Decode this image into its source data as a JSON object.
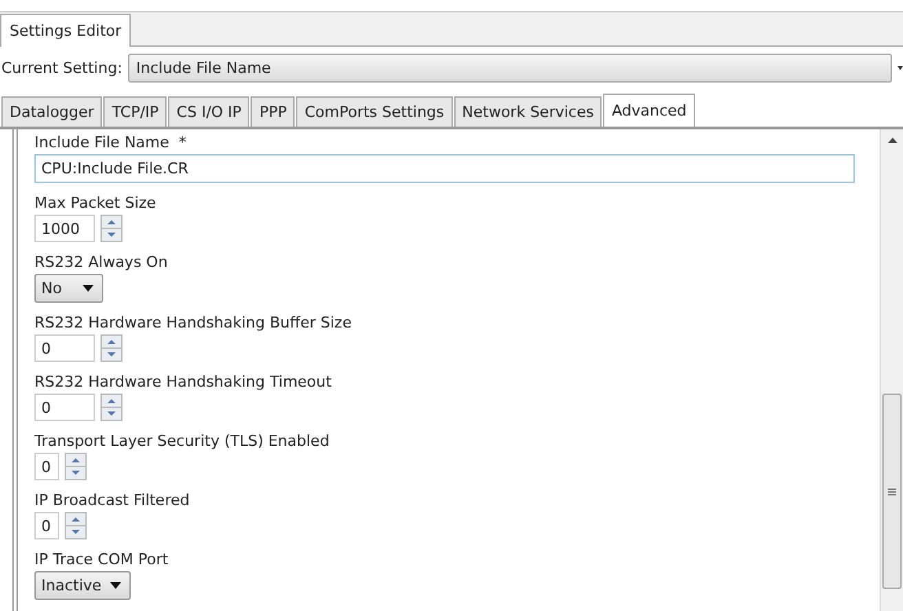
{
  "window_tab": {
    "label": "Settings Editor",
    "selected": true
  },
  "current_setting": {
    "label": "Current Setting:",
    "value": "Include File Name"
  },
  "tabs": [
    {
      "label": "Datalogger",
      "selected": false
    },
    {
      "label": "TCP/IP",
      "selected": false
    },
    {
      "label": "CS I/O IP",
      "selected": false
    },
    {
      "label": "PPP",
      "selected": false
    },
    {
      "label": "ComPorts Settings",
      "selected": false
    },
    {
      "label": "Network Services",
      "selected": false
    },
    {
      "label": "Advanced",
      "selected": true
    }
  ],
  "fields": [
    {
      "kind": "text",
      "label": "Include File Name  *",
      "value": "CPU:Include File.CR"
    },
    {
      "kind": "spin",
      "label": "Max Packet Size",
      "value": "1000"
    },
    {
      "kind": "select",
      "label": "RS232 Always On",
      "value": "No"
    },
    {
      "kind": "spin",
      "label": "RS232 Hardware Handshaking Buffer Size",
      "value": "0"
    },
    {
      "kind": "spin",
      "label": "RS232 Hardware Handshaking Timeout",
      "value": "0"
    },
    {
      "kind": "small-spin",
      "label": "Transport Layer Security (TLS) Enabled",
      "value": "0"
    },
    {
      "kind": "small-spin",
      "label": "IP Broadcast Filtered",
      "value": "0"
    },
    {
      "kind": "select-wide",
      "label": "IP Trace COM Port",
      "value": "Inactive"
    }
  ]
}
